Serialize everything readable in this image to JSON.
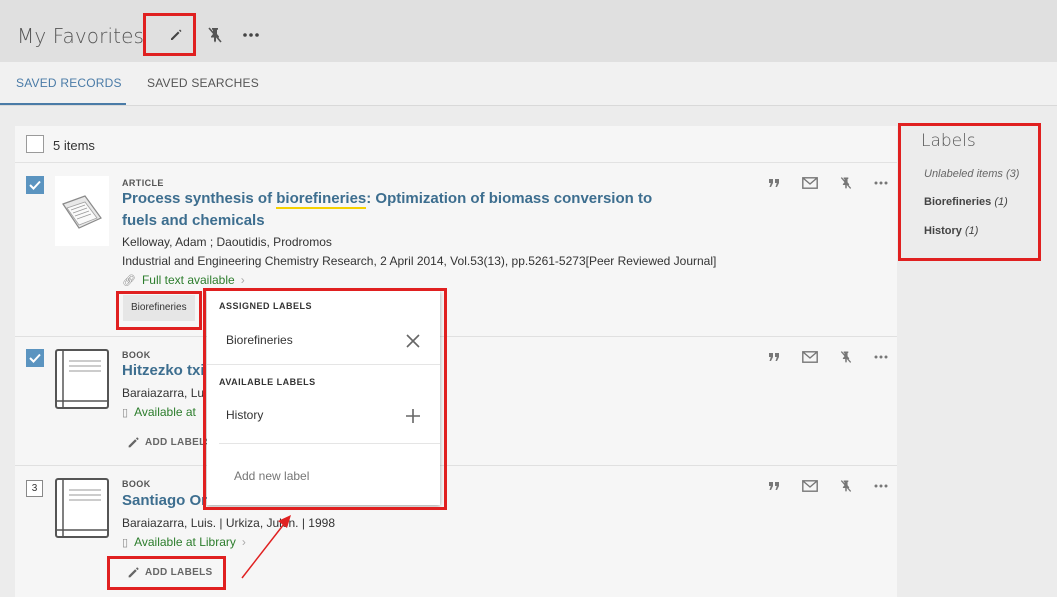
{
  "header": {
    "title": "My Favorites",
    "buttons": [
      "pencil-icon",
      "unpin-icon",
      "more-icon"
    ]
  },
  "tabs": [
    {
      "label": "SAVED RECORDS",
      "active": true
    },
    {
      "label": "SAVED SEARCHES",
      "active": false
    }
  ],
  "list": {
    "count_label": "5 items",
    "records": [
      {
        "type": "ARTICLE",
        "title_pre": "Process synthesis of ",
        "title_highlight": "biorefineries",
        "title_post": ": Optimization of biomass conversion to fuels and chemicals",
        "authors": "Kelloway, Adam ; Daoutidis, Prodromos",
        "source": "Industrial and Engineering Chemistry Research, 2 April 2014, Vol.53(13), pp.5261-5273[Peer Reviewed Journal]",
        "availability": "Full text available",
        "label": "Biorefineries",
        "checked": true
      },
      {
        "type": "BOOK",
        "title": "Hitzezko txi",
        "authors": "Baraiazarra, Lui",
        "availability": "Available at",
        "add_labels": "ADD LABELS",
        "checked": true
      },
      {
        "type": "BOOK",
        "title": "Santiago Or",
        "title_tail": "",
        "authors": "Baraiazarra, Luis. | Urkiza, Julen. | 1998",
        "availability": "Available at Library",
        "add_labels": "ADD LABELS",
        "number": "3"
      }
    ]
  },
  "popup": {
    "assigned_heading": "ASSIGNED LABELS",
    "assigned": [
      "Biorefineries"
    ],
    "available_heading": "AVAILABLE LABELS",
    "available": [
      "History"
    ],
    "new_label_placeholder": "Add new label"
  },
  "labels_panel": {
    "title": "Labels",
    "items": [
      {
        "name": "Unlabeled items",
        "count": "(3)"
      },
      {
        "name": "Biorefineries",
        "count": "(1)"
      },
      {
        "name": "History",
        "count": "(1)"
      }
    ]
  },
  "colors": {
    "accent": "#4a7ba7",
    "title_link": "#3d6e8f",
    "available": "#2c7d2c",
    "annotation": "#e02020",
    "highlight": "#f5d000"
  }
}
